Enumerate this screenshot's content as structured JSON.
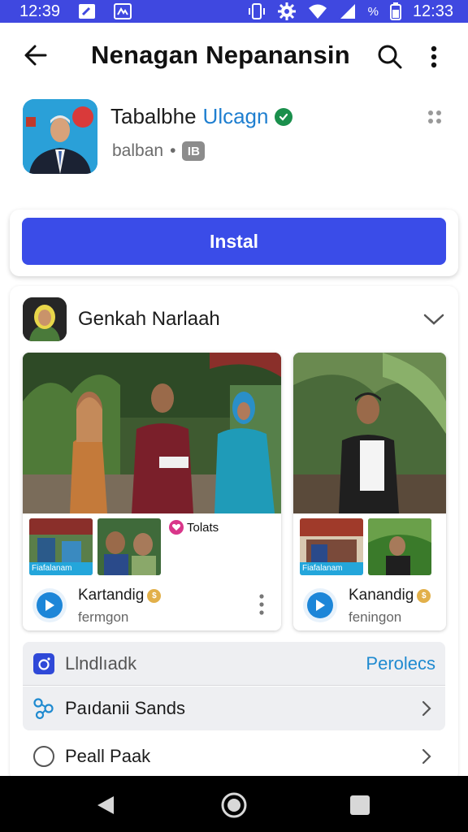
{
  "status_bar": {
    "time_left": "12:39",
    "time_right": "12:33",
    "battery_text": "%"
  },
  "app_bar": {
    "title": "Nenagan Nepanansin"
  },
  "app": {
    "name_part1": "Tabalbhe",
    "name_part2": "Ulcagn",
    "developer": "balban",
    "rating_badge": "IB",
    "accent_color": "#1f7fd0"
  },
  "install": {
    "label": "Instal",
    "color": "#3a4ce8"
  },
  "section": {
    "title": "Genkah Narlaah"
  },
  "videos": [
    {
      "thumb_caption": "Fiafalanam",
      "chip_label": "Tolats",
      "title": "Kartandig",
      "subtitle": "fermgon"
    },
    {
      "thumb_caption": "Fiafalanam",
      "title": "Kanandig",
      "subtitle": "feningon"
    }
  ],
  "list": [
    {
      "label": "Llndlıadk",
      "action": "Perolecs",
      "icon": "instagram-icon"
    },
    {
      "label": "Paıdanii Sands",
      "icon": "share-nodes-icon"
    },
    {
      "label": "Peall Paak",
      "icon": "circle-icon"
    }
  ]
}
